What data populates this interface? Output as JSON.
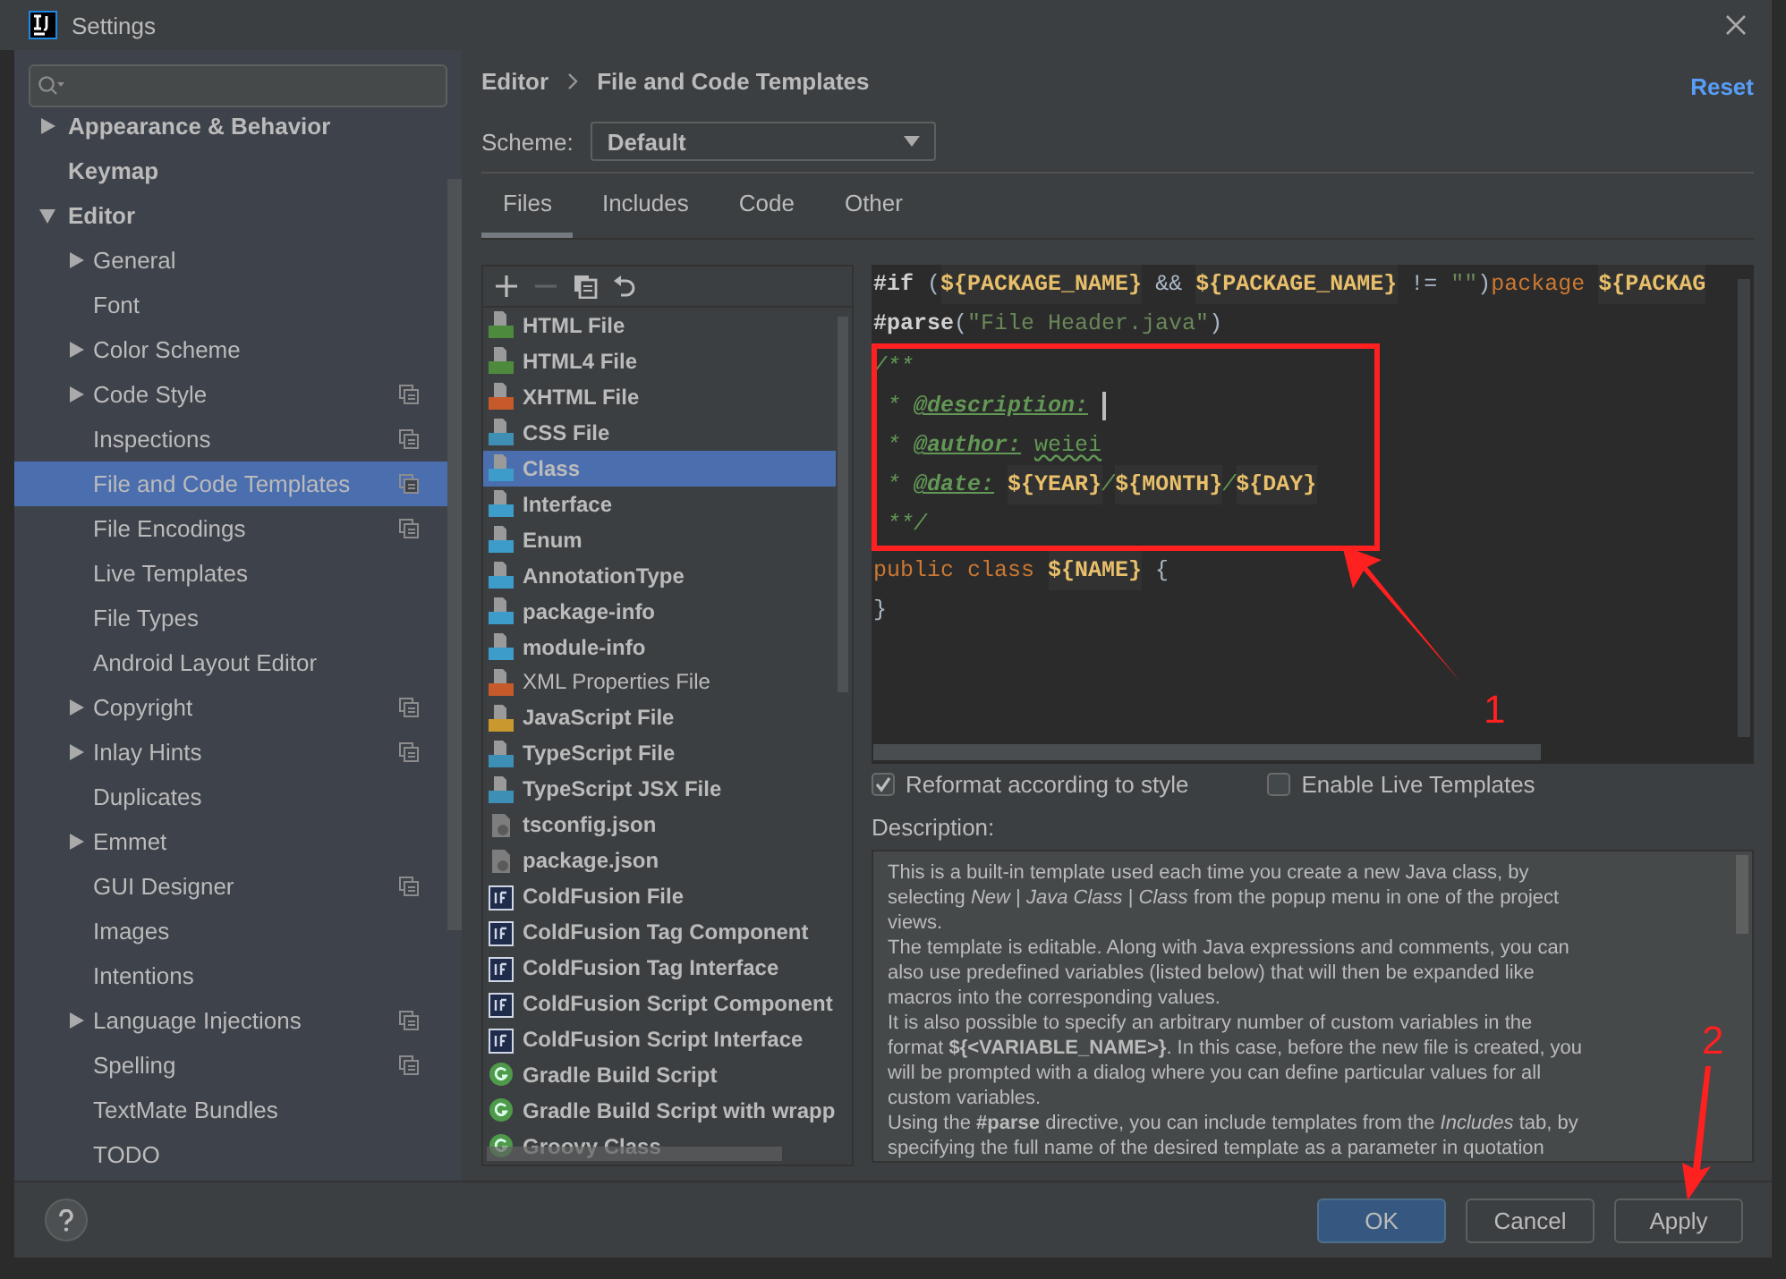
{
  "window": {
    "title": "Settings"
  },
  "sidebar": {
    "items": [
      {
        "label": "Appearance & Behavior",
        "kind": "collapsed",
        "project": false,
        "selected": false
      },
      {
        "label": "Keymap",
        "kind": "leaf",
        "project": false,
        "selected": false
      },
      {
        "label": "Editor",
        "kind": "expanded",
        "project": false,
        "selected": false,
        "children": [
          {
            "label": "General",
            "kind": "collapsed",
            "project": false,
            "selected": false
          },
          {
            "label": "Font",
            "kind": "leaf",
            "project": false,
            "selected": false
          },
          {
            "label": "Color Scheme",
            "kind": "collapsed",
            "project": false,
            "selected": false
          },
          {
            "label": "Code Style",
            "kind": "collapsed",
            "project": true,
            "selected": false
          },
          {
            "label": "Inspections",
            "kind": "leaf",
            "project": true,
            "selected": false
          },
          {
            "label": "File and Code Templates",
            "kind": "leaf",
            "project": true,
            "selected": true
          },
          {
            "label": "File Encodings",
            "kind": "leaf",
            "project": true,
            "selected": false
          },
          {
            "label": "Live Templates",
            "kind": "leaf",
            "project": false,
            "selected": false
          },
          {
            "label": "File Types",
            "kind": "leaf",
            "project": false,
            "selected": false
          },
          {
            "label": "Android Layout Editor",
            "kind": "leaf",
            "project": false,
            "selected": false
          },
          {
            "label": "Copyright",
            "kind": "collapsed",
            "project": true,
            "selected": false
          },
          {
            "label": "Inlay Hints",
            "kind": "collapsed",
            "project": true,
            "selected": false
          },
          {
            "label": "Duplicates",
            "kind": "leaf",
            "project": false,
            "selected": false
          },
          {
            "label": "Emmet",
            "kind": "collapsed",
            "project": false,
            "selected": false
          },
          {
            "label": "GUI Designer",
            "kind": "leaf",
            "project": true,
            "selected": false
          },
          {
            "label": "Images",
            "kind": "leaf",
            "project": false,
            "selected": false
          },
          {
            "label": "Intentions",
            "kind": "leaf",
            "project": false,
            "selected": false
          },
          {
            "label": "Language Injections",
            "kind": "collapsed",
            "project": true,
            "selected": false
          },
          {
            "label": "Spelling",
            "kind": "leaf",
            "project": true,
            "selected": false
          },
          {
            "label": "TextMate Bundles",
            "kind": "leaf",
            "project": false,
            "selected": false
          },
          {
            "label": "TODO",
            "kind": "leaf",
            "project": false,
            "selected": false
          }
        ]
      }
    ]
  },
  "breadcrumb": [
    "Editor",
    "File and Code Templates"
  ],
  "reset": "Reset",
  "scheme": {
    "label": "Scheme:",
    "value": "Default"
  },
  "tabs": [
    {
      "label": "Files",
      "selected": true
    },
    {
      "label": "Includes",
      "selected": false
    },
    {
      "label": "Code",
      "selected": false
    },
    {
      "label": "Other",
      "selected": false
    }
  ],
  "templates": [
    {
      "name": "HTML File",
      "kind": "html",
      "bold": true,
      "selected": false
    },
    {
      "name": "HTML4 File",
      "kind": "html",
      "bold": true,
      "selected": false
    },
    {
      "name": "XHTML File",
      "kind": "xhtml",
      "bold": true,
      "selected": false
    },
    {
      "name": "CSS File",
      "kind": "css",
      "bold": true,
      "selected": false
    },
    {
      "name": "Class",
      "kind": "java",
      "bold": true,
      "selected": true
    },
    {
      "name": "Interface",
      "kind": "java",
      "bold": true,
      "selected": false
    },
    {
      "name": "Enum",
      "kind": "java",
      "bold": true,
      "selected": false
    },
    {
      "name": "AnnotationType",
      "kind": "java",
      "bold": true,
      "selected": false
    },
    {
      "name": "package-info",
      "kind": "java",
      "bold": true,
      "selected": false
    },
    {
      "name": "module-info",
      "kind": "java",
      "bold": true,
      "selected": false
    },
    {
      "name": "XML Properties File",
      "kind": "xml",
      "bold": false,
      "selected": false
    },
    {
      "name": "JavaScript File",
      "kind": "js",
      "bold": true,
      "selected": false
    },
    {
      "name": "TypeScript File",
      "kind": "ts",
      "bold": true,
      "selected": false
    },
    {
      "name": "TypeScript JSX File",
      "kind": "ts",
      "bold": true,
      "selected": false
    },
    {
      "name": "tsconfig.json",
      "kind": "json",
      "bold": true,
      "selected": false
    },
    {
      "name": "package.json",
      "kind": "json",
      "bold": true,
      "selected": false
    },
    {
      "name": "ColdFusion File",
      "kind": "cf",
      "bold": true,
      "selected": false
    },
    {
      "name": "ColdFusion Tag Component",
      "kind": "cf",
      "bold": true,
      "selected": false
    },
    {
      "name": "ColdFusion Tag Interface",
      "kind": "cf",
      "bold": true,
      "selected": false
    },
    {
      "name": "ColdFusion Script Component",
      "kind": "cf",
      "bold": true,
      "selected": false
    },
    {
      "name": "ColdFusion Script Interface",
      "kind": "cf",
      "bold": true,
      "selected": false
    },
    {
      "name": "Gradle Build Script",
      "kind": "gradle",
      "bold": true,
      "selected": false
    },
    {
      "name": "Gradle Build Script with wrapp",
      "kind": "gradle",
      "bold": true,
      "selected": false
    },
    {
      "name": "Groovy Class",
      "kind": "gradle",
      "bold": true,
      "selected": false
    }
  ],
  "editor": {
    "lines": [
      {
        "caret": false,
        "tokens": [
          {
            "kind": "directive",
            "text": "#if"
          },
          {
            "kind": "plain",
            "text": " ("
          },
          {
            "kind": "var",
            "text": "${PACKAGE_NAME}"
          },
          {
            "kind": "plain",
            "text": " && "
          },
          {
            "kind": "var",
            "text": "${PACKAGE_NAME}"
          },
          {
            "kind": "plain",
            "text": " != "
          },
          {
            "kind": "string",
            "text": "\"\""
          },
          {
            "kind": "plain",
            "text": ")"
          },
          {
            "kind": "keyword",
            "text": "package "
          },
          {
            "kind": "var",
            "text": "${PACKAG"
          }
        ]
      },
      {
        "caret": false,
        "tokens": [
          {
            "kind": "directive",
            "text": "#parse"
          },
          {
            "kind": "plain",
            "text": "("
          },
          {
            "kind": "string",
            "text": "\"File Header.java\""
          },
          {
            "kind": "plain",
            "text": ")"
          }
        ]
      },
      {
        "caret": false,
        "tokens": [
          {
            "kind": "doc",
            "text": "/**"
          }
        ]
      },
      {
        "caret": true,
        "tokens": [
          {
            "kind": "doc",
            "text": " * "
          },
          {
            "kind": "doctag",
            "text": "@description:"
          }
        ]
      },
      {
        "caret": false,
        "tokens": [
          {
            "kind": "doc",
            "text": " * "
          },
          {
            "kind": "doctag",
            "text": "@author:"
          },
          {
            "kind": "docvalue",
            "text": "weiei"
          }
        ]
      },
      {
        "caret": false,
        "tokens": [
          {
            "kind": "doc",
            "text": " * "
          },
          {
            "kind": "doctag",
            "text": "@date:"
          },
          {
            "kind": "var",
            "text": "${YEAR}"
          },
          {
            "kind": "doc",
            "text": "/"
          },
          {
            "kind": "var",
            "text": "${MONTH}"
          },
          {
            "kind": "doc",
            "text": "/"
          },
          {
            "kind": "var",
            "text": "${DAY}"
          }
        ]
      },
      {
        "caret": false,
        "tokens": [
          {
            "kind": "doc",
            "text": " **/"
          }
        ]
      },
      {
        "caret": false,
        "tokens": [
          {
            "kind": "keyword",
            "text": "public class "
          },
          {
            "kind": "var",
            "text": "${NAME}"
          },
          {
            "kind": "plain",
            "text": " {"
          }
        ]
      },
      {
        "caret": false,
        "tokens": [
          {
            "kind": "plain",
            "text": "}"
          }
        ]
      }
    ]
  },
  "options": [
    {
      "label": "Reformat according to style",
      "checked": true
    },
    {
      "label": "Enable Live Templates",
      "checked": false
    }
  ],
  "description": {
    "label": "Description:",
    "lines": [
      "This is a built-in template used each time you create a new Java class, by",
      "selecting *New* | *Java Class* | *Class* from the popup menu in one of the project",
      "views.",
      "The template is editable. Along with Java expressions and comments, you can",
      "also use predefined variables (listed below) that will then be expanded like",
      "macros into the corresponding values.",
      "It is also possible to specify an arbitrary number of custom variables in the",
      "format **${<VARIABLE_NAME>}**. In this case, before the new file is created, you",
      "will be prompted with a dialog where you can define particular values for all",
      "custom variables.",
      "Using the **#parse** directive, you can include templates from the *Includes* tab, by",
      "specifying the full name of the desired template as a parameter in quotation"
    ]
  },
  "buttons": [
    {
      "label": "OK",
      "kind": "primary"
    },
    {
      "label": "Cancel",
      "kind": "default"
    },
    {
      "label": "Apply",
      "kind": "default"
    }
  ],
  "annotations": {
    "labels": [
      "1",
      "2"
    ]
  }
}
